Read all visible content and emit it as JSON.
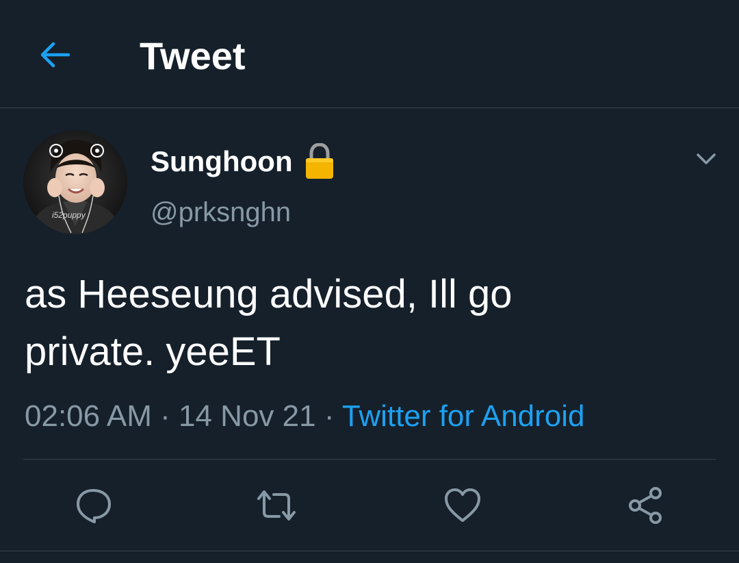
{
  "header": {
    "title": "Tweet",
    "back_icon": "arrow-left-icon"
  },
  "tweet": {
    "display_name": "Sunghoon",
    "lock_icon": "lock-icon",
    "handle": "@prksnghn",
    "text": "as Heeseung advised, Ill go\nprivate. yeeET",
    "time": "02:06 AM",
    "separator": " · ",
    "date": "14 Nov 21",
    "source": "Twitter for Android",
    "avatar_watermark": "i52puppy"
  },
  "actions": [
    {
      "name": "reply",
      "icon": "reply-icon"
    },
    {
      "name": "retweet",
      "icon": "retweet-icon"
    },
    {
      "name": "like",
      "icon": "heart-icon"
    },
    {
      "name": "share",
      "icon": "share-icon"
    }
  ],
  "colors": {
    "background": "#15202b",
    "accent": "#1da1f2",
    "secondary_text": "#8899a6",
    "divider": "#38444d",
    "lock": "#f4b400"
  }
}
